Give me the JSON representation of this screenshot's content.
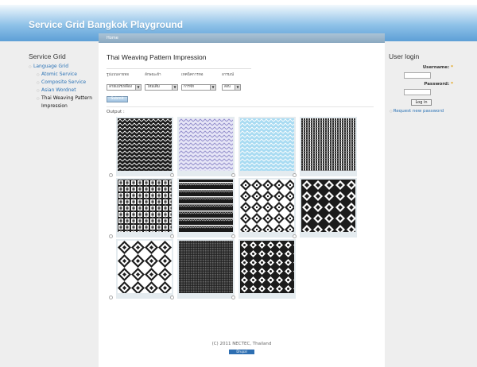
{
  "header": {
    "site_name": "Service Grid Bangkok Playground"
  },
  "left_sidebar": {
    "title": "Service Grid",
    "items": [
      {
        "label": "Language Grid"
      },
      {
        "label": "Atomic Service"
      },
      {
        "label": "Composite Service"
      },
      {
        "label": "Asian Wordnet"
      },
      {
        "label": "Thai Weaving Pattern Impression"
      }
    ]
  },
  "main": {
    "breadcrumb": "Home",
    "title": "Thai Weaving Pattern Impression",
    "form": {
      "labels": [
        "รูปแบบลายทอ",
        "ลักษณะผ้า",
        "เทคนิคการทอ",
        "อารมณ์"
      ],
      "selects": [
        "ลายแปรเหลือง",
        "ไหมเดิม",
        "การจัก",
        "สงบ"
      ],
      "submit_label": "Submit"
    },
    "output_label": "Output :",
    "footer": "(C) 2011 NECTEC, Thailand",
    "powered_by": "Drupal"
  },
  "right_sidebar": {
    "title": "User login",
    "username_label": "Username:",
    "password_label": "Password:",
    "required_mark": "*",
    "login_button": "Log in",
    "request_password": "Request new password"
  },
  "colors": {
    "header_top": "#f3f9fd",
    "header_bottom": "#5d9fd6",
    "link": "#2a72b5",
    "breadcrumb_bar": "#9ab6cc"
  }
}
